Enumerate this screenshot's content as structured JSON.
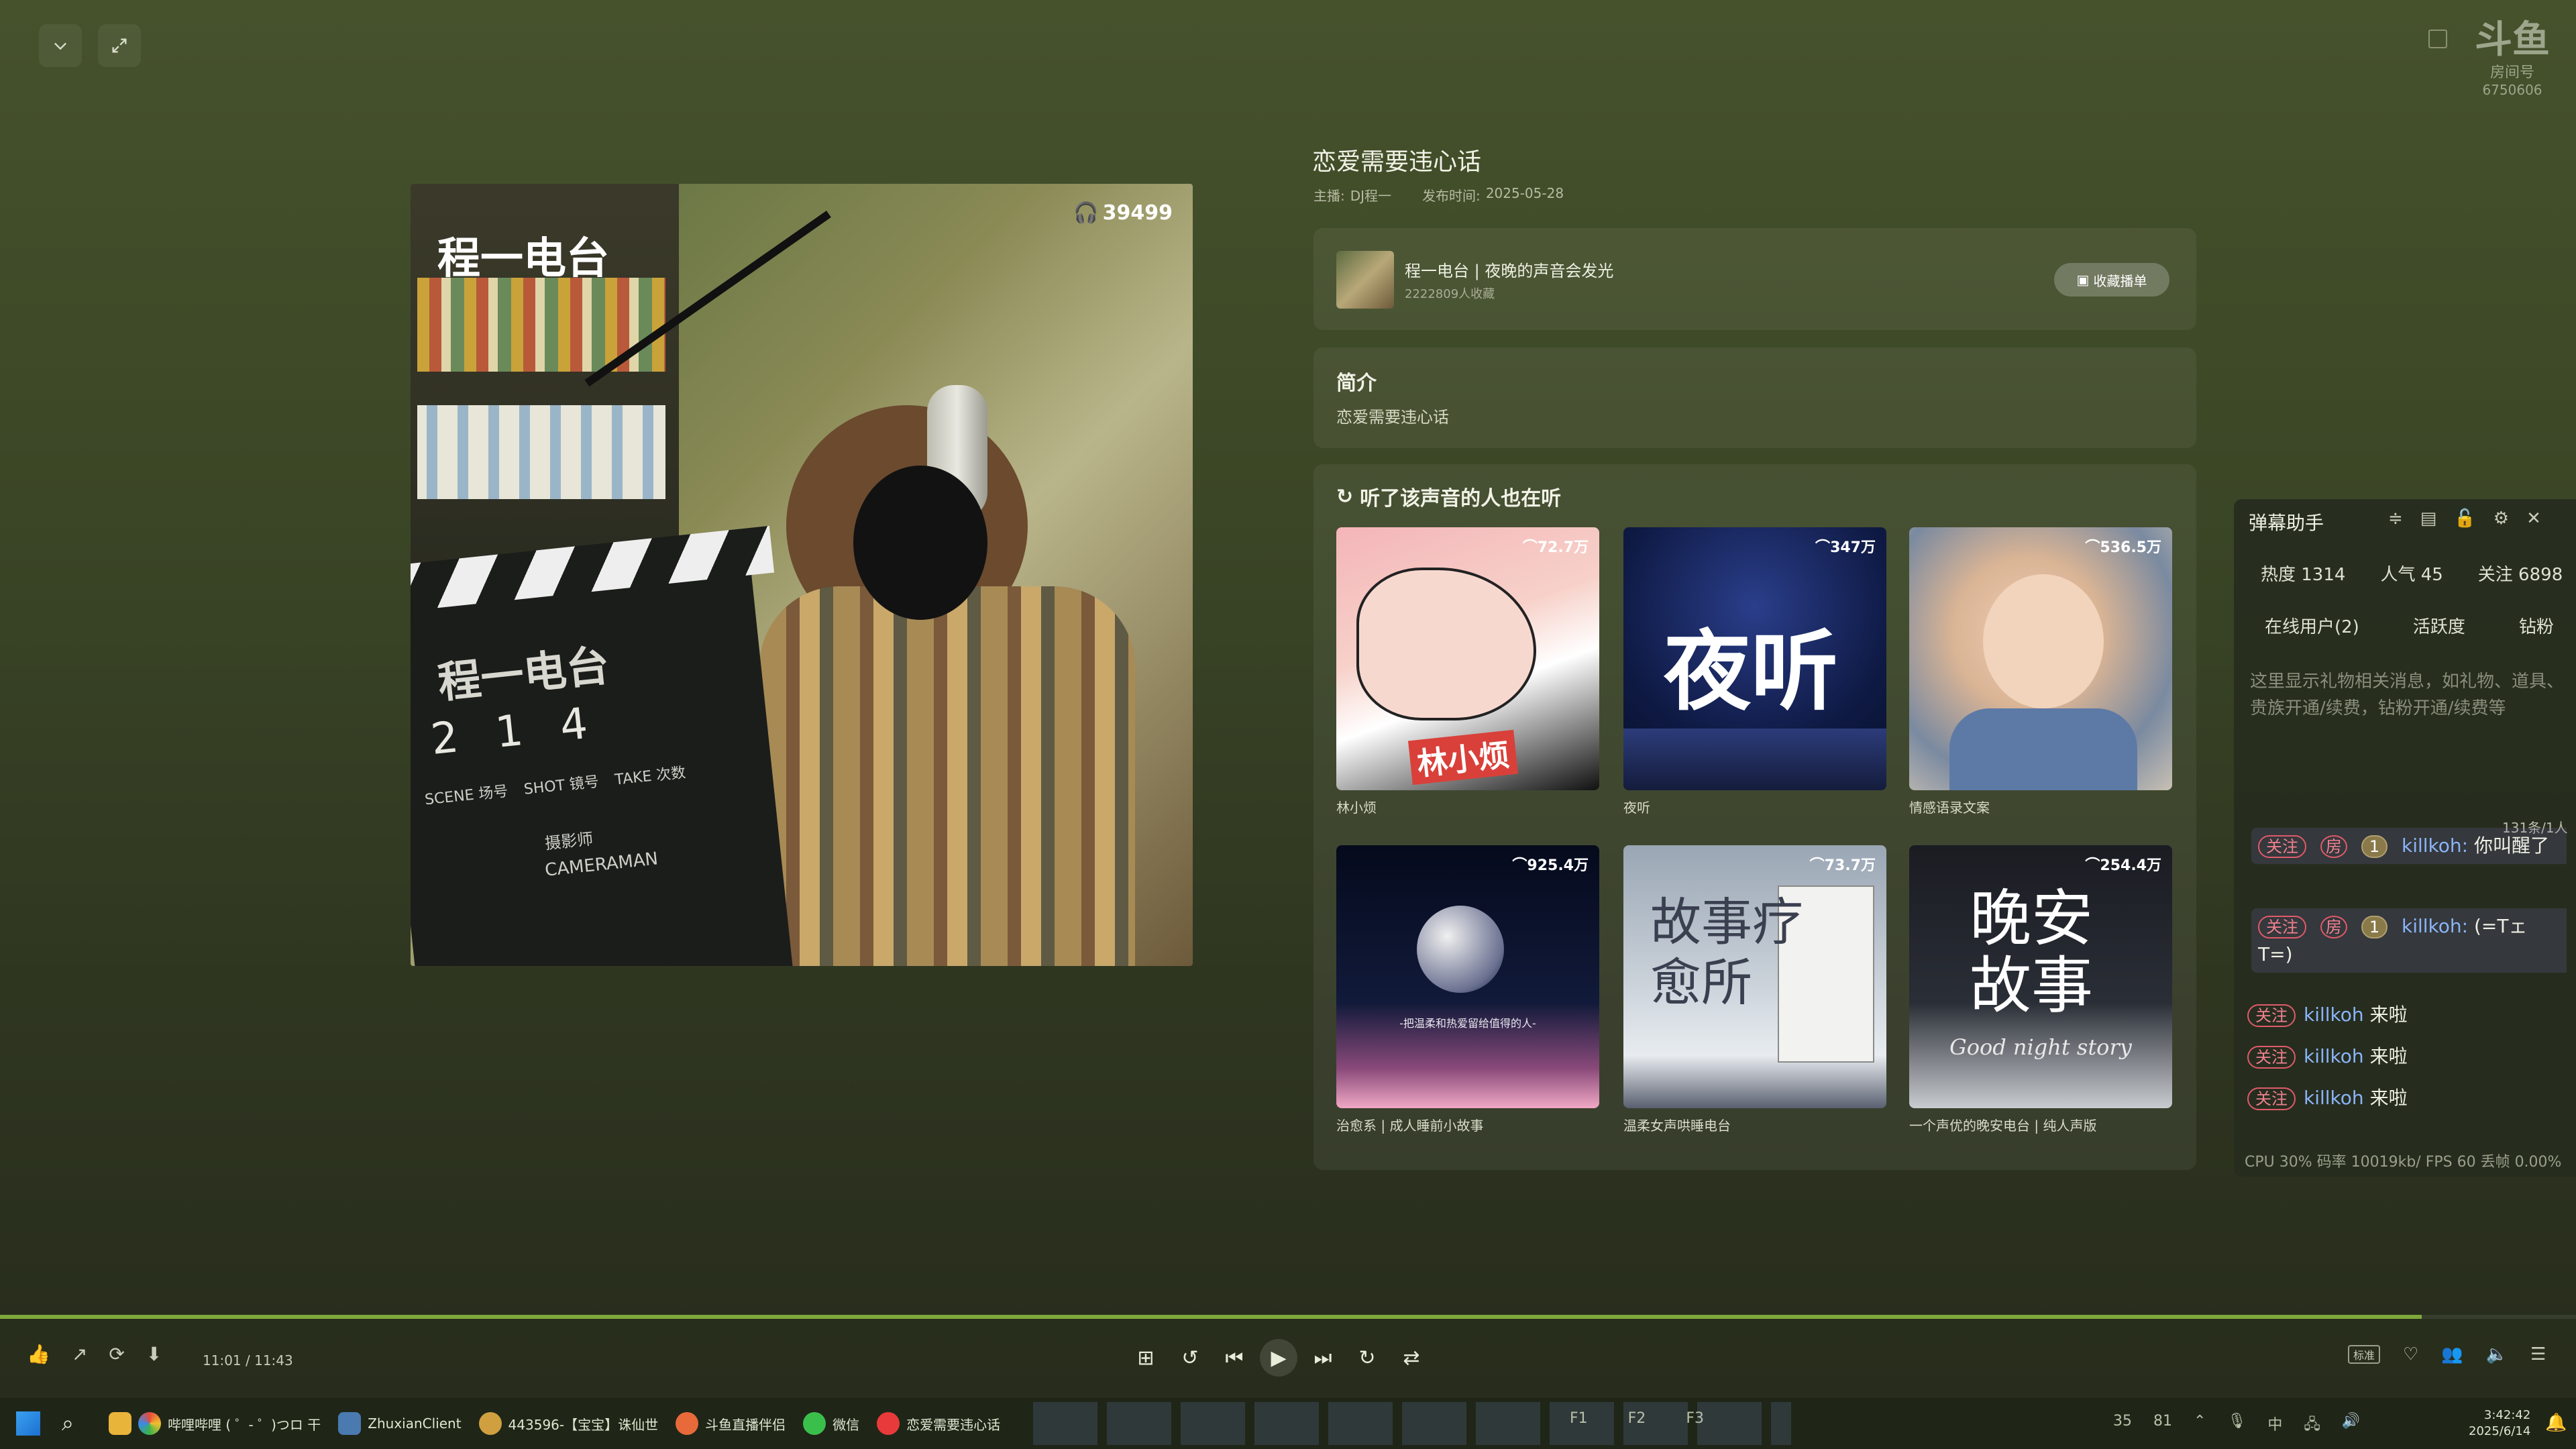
{
  "window": {
    "collapse_label": "collapse",
    "fullscreen_label": "fullscreen",
    "watermark_id": "6750606",
    "watermark_sub": "房间号"
  },
  "cover": {
    "play_count": "39499",
    "title_overlay": "程一电台",
    "slate_text": "程一电台",
    "slate_labels": [
      "SCENE 场号",
      "SHOT 镜号",
      "TAKE 次数"
    ],
    "slate_numbers": [
      "2",
      "1",
      "4"
    ],
    "slate_camera": "CAMERAMAN",
    "slate_director": "摄影师"
  },
  "episode": {
    "title": "恋爱需要违心话",
    "host_label": "主播:",
    "host": "DJ程一",
    "date_label": "发布时间:",
    "date": "2025-05-28"
  },
  "album": {
    "name": "程一电台 | 夜晚的声音会发光",
    "subs": "2222809人收藏",
    "collect_button": "收藏播单"
  },
  "intro": {
    "heading": "简介",
    "text": "恋爱需要违心话"
  },
  "recommend": {
    "heading": "听了该声音的人也在听",
    "items": [
      {
        "title": "林小烦",
        "count": "72.7万",
        "overlay": "林小烦"
      },
      {
        "title": "夜听",
        "count": "347万",
        "overlay": "夜听"
      },
      {
        "title": "情感语录文案",
        "count": "536.5万",
        "overlay": ""
      },
      {
        "title": "治愈系 | 成人睡前小故事",
        "count": "925.4万",
        "overlay": "-把温柔和热爱留给值得的人-"
      },
      {
        "title": "温柔女声哄睡电台",
        "count": "73.7万",
        "overlay": "故事疗愈所"
      },
      {
        "title": "一个声优的晚安电台 | 纯人声版",
        "count": "254.4万",
        "overlay": "晚安故事"
      }
    ],
    "overlay_sub": "Good night story"
  },
  "danmu": {
    "title": "弹幕助手",
    "stats": [
      "热度 1314",
      "人气 45",
      "关注 6898"
    ],
    "tabs": [
      "在线用户(2)",
      "活跃度",
      "钻粉"
    ],
    "gift_hint": "这里显示礼物相关消息，如礼物、道具、贵族开通/续费，钻粉开通/续费等",
    "counter": "131条/1人",
    "messages": [
      {
        "badge1": "关注",
        "badge2": "房",
        "level": "1",
        "user": "killkoh:",
        "text": "你叫醒了"
      },
      {
        "badge1": "关注",
        "badge2": "房",
        "level": "1",
        "user": "killkoh:",
        "text": "(=Tェ T=)"
      }
    ],
    "enters": [
      {
        "badge": "关注",
        "user": "killkoh",
        "text": "来啦"
      },
      {
        "badge": "关注",
        "user": "killkoh",
        "text": "来啦"
      },
      {
        "badge": "关注",
        "user": "killkoh",
        "text": "来啦"
      }
    ],
    "status": "CPU 30%  码率 10019kb/  FPS 60  丢帧 0.00%"
  },
  "player": {
    "time": "11:01 / 11:43",
    "progress": 0.94,
    "quality": "标准"
  },
  "taskbar": {
    "items": [
      "哔哩哔哩 ( ゜- ゜)つロ 干",
      "ZhuxianClient",
      "443596-【宝宝】诛仙世",
      "斗鱼直播伴侣",
      "微信",
      "恋爱需要违心话"
    ],
    "keys": [
      "F1",
      "F2",
      "F3"
    ],
    "tray_values": [
      "35",
      "81"
    ],
    "ime": "中",
    "clock_time": "3:42:42",
    "clock_date": "2025/6/14"
  },
  "colors": {
    "accent_progress": "#7fa83a",
    "badge_pink": "#e05a6a",
    "username_blue": "#8ab4f8"
  }
}
